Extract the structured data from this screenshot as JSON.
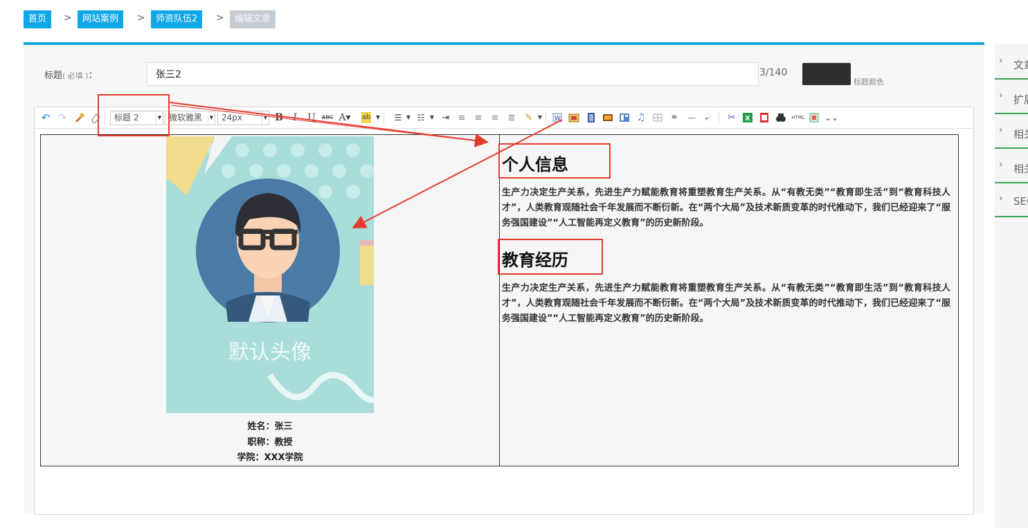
{
  "breadcrumb": {
    "items": [
      "首页",
      "网站案例",
      "师资队伍2",
      "编辑文章"
    ],
    "separator": ">"
  },
  "form": {
    "title_label": "标题",
    "title_required": "( 必填 )",
    "title_colon": "：",
    "title_value": "张三2",
    "char_counter": "3/140",
    "color_label": "标题颜色",
    "title_color": "#2e2e2e"
  },
  "toolbar": {
    "heading_select": "标题 2",
    "font_select": "微软雅黑",
    "size_select": "24px",
    "icons": [
      "undo-icon",
      "redo-icon",
      "format-painter-icon",
      "eraser-icon",
      "bold-icon",
      "italic-icon",
      "underline-icon",
      "strikethrough-icon",
      "font-color-icon",
      "highlight-icon",
      "ordered-list-icon",
      "unordered-list-icon",
      "indent-icon",
      "align-left-icon",
      "align-center-icon",
      "align-right-icon",
      "justify-icon",
      "magic-icon",
      "word-import-icon",
      "image-icon",
      "video-icon",
      "gallery-icon",
      "template-icon",
      "music-icon",
      "table-icon",
      "link-icon",
      "horizontal-rule-icon",
      "page-break-icon",
      "attachment-icon",
      "excel-icon",
      "pdf-icon",
      "search-icon",
      "html-icon",
      "map-icon",
      "more-icon"
    ],
    "html_label": "HTML"
  },
  "content": {
    "avatar_text": "默认头像",
    "caption": [
      "姓名：张三",
      "职称：教授",
      "学院：XXX学院"
    ],
    "sections": [
      {
        "heading": "个人信息",
        "body": "生产力决定生产关系，先进生产力赋能教育将重塑教育生产关系。从“有教无类”“教育即生活”到“教育科技人才”，人类教育观随社会千年发展而不断衍新。在“两个大局”及技术新质变革的时代推动下，我们已经迎来了“服务强国建设”“人工智能再定义教育”的历史新阶段。"
      },
      {
        "heading": "教育经历",
        "body": "生产力决定生产关系，先进生产力赋能教育将重塑教育生产关系。从“有教无类”“教育即生活”到“教育科技人才”，人类教育观随社会千年发展而不断衍新。在“两个大局”及技术新质变革的时代推动下，我们已经迎来了“服务强国建设”“人工智能再定义教育”的历史新阶段。"
      }
    ]
  },
  "sidebar": {
    "items": [
      "文章",
      "扩展",
      "相关",
      "相关",
      "SEO"
    ]
  },
  "colors": {
    "accent": "#14a3e0",
    "crumb": "#0ea7e7",
    "annotation": "#e53b2e",
    "sidebar_border": "#3aa357"
  }
}
